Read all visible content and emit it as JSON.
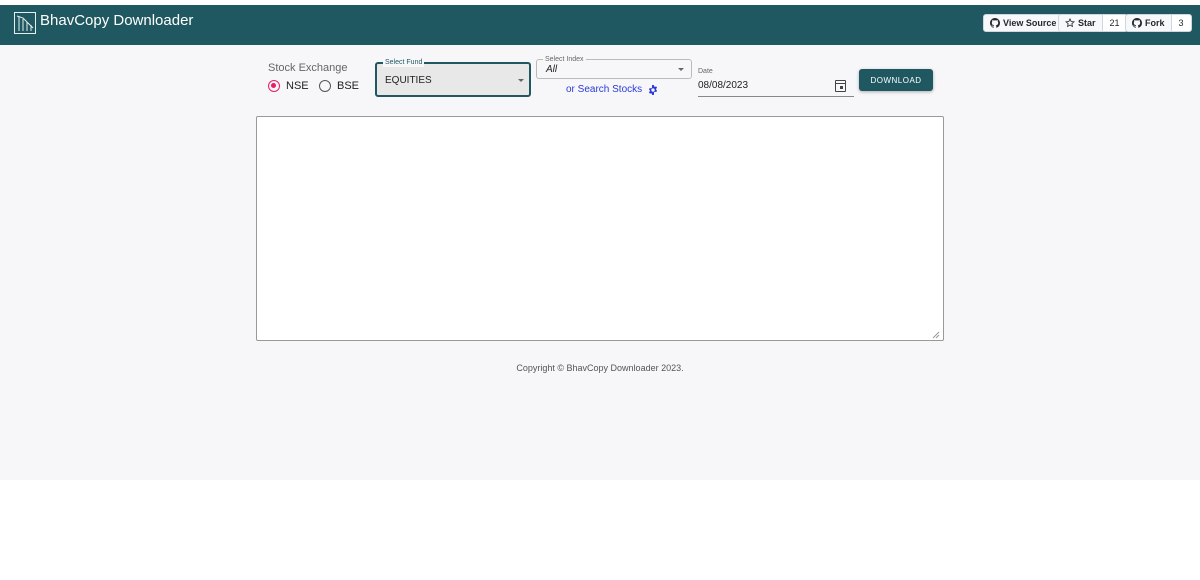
{
  "navbar": {
    "brand": "BhavCopy Downloader",
    "view_source": "View Source",
    "star_label": "Star",
    "star_count": "21",
    "fork_label": "Fork",
    "fork_count": "3",
    "background_color": "#1f5860"
  },
  "exchange": {
    "label": "Stock Exchange",
    "options": [
      "NSE",
      "BSE"
    ],
    "selected": "NSE",
    "selected_color": "#e91e63"
  },
  "fund": {
    "legend": "Select Fund",
    "value": "EQUITIES"
  },
  "index": {
    "legend": "Select Index",
    "value": "All",
    "search_link": "or Search Stocks"
  },
  "date": {
    "label": "Date",
    "value": "08/08/2023"
  },
  "download": {
    "label": "DOWNLOAD"
  },
  "output": {
    "value": ""
  },
  "footer": {
    "copyright": "Copyright © BhavCopy Downloader 2023."
  },
  "icons": [
    "logo-icon",
    "github-icon",
    "star-icon",
    "caret-down-icon",
    "gear-icon",
    "calendar-icon",
    "resize-grip-icon"
  ]
}
